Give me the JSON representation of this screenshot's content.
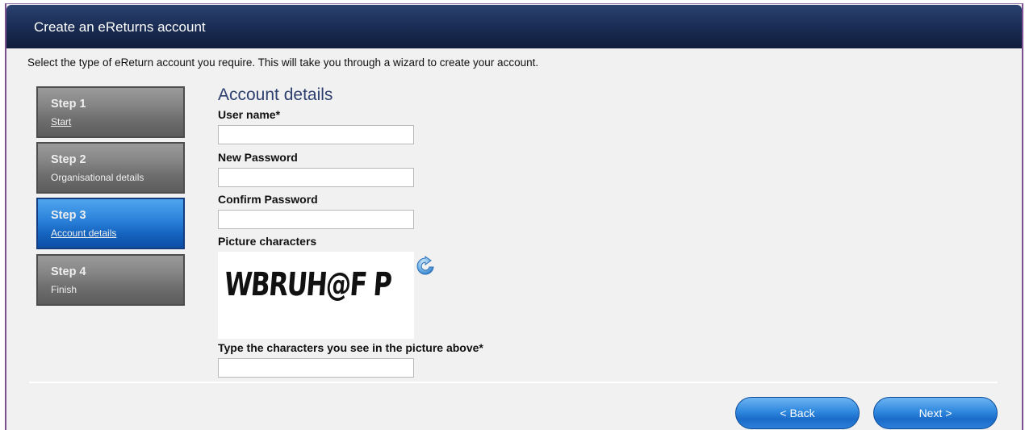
{
  "window": {
    "title": "Create an eReturns account"
  },
  "intro": "Select the type of eReturn account you require. This will take you through a wizard to create your account.",
  "steps": [
    {
      "label": "Step 1",
      "sub": "Start"
    },
    {
      "label": "Step 2",
      "sub": "Organisational details"
    },
    {
      "label": "Step 3",
      "sub": "Account details"
    },
    {
      "label": "Step 4",
      "sub": "Finish"
    }
  ],
  "active_step": 3,
  "form": {
    "heading": "Account details",
    "username_label": "User name*",
    "username_value": "",
    "new_password_label": "New Password",
    "new_password_value": "",
    "confirm_password_label": "Confirm Password",
    "confirm_password_value": "",
    "picture_label": "Picture characters",
    "captcha_text": "WBRUH@F P",
    "captcha_input_label": "Type the characters you see in the picture above*",
    "captcha_input_value": ""
  },
  "icons": {
    "refresh": "refresh-icon"
  },
  "buttons": {
    "back": "< Back",
    "next": "Next >"
  },
  "colors": {
    "titlebar": "#1c2f57",
    "active_step": "#2a80d8",
    "button": "#2f88de",
    "heading": "#2d3f6e"
  }
}
